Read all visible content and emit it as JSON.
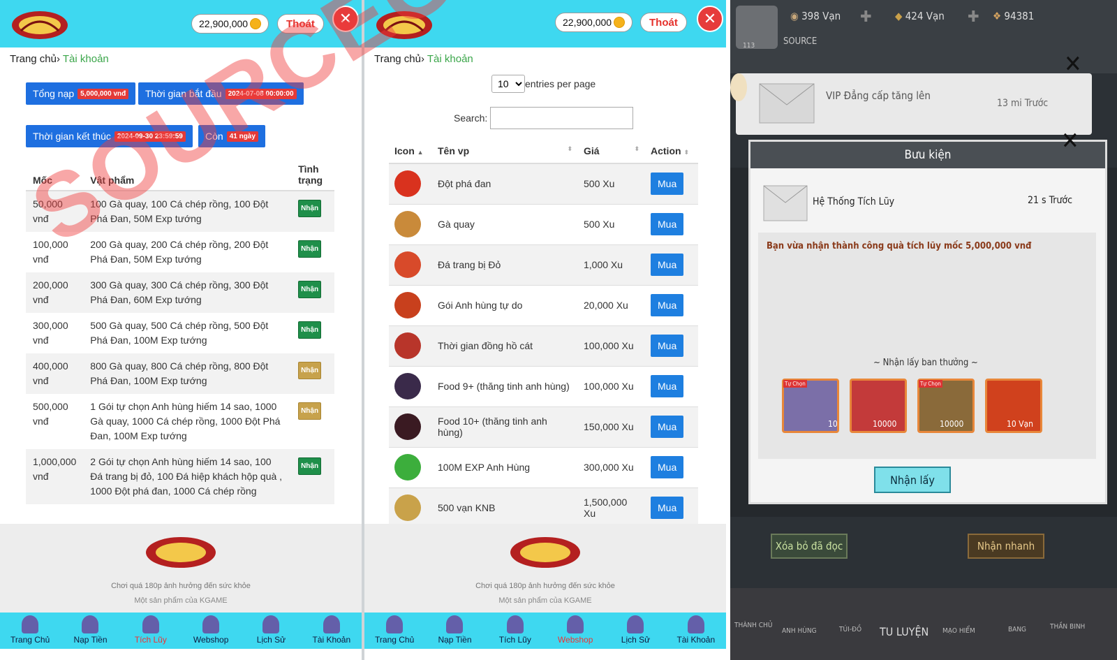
{
  "header": {
    "balance": "22,900,000",
    "logout": "Thoát"
  },
  "p1": {
    "breadcrumb_home": "Trang chủ›",
    "breadcrumb_current": "Tài khoản",
    "pills": [
      {
        "label": "Tổng nạp",
        "badge": "5,000,000 vnđ"
      },
      {
        "label": "Thời gian bắt đầu",
        "badge": "2024-07-08 00:00:00"
      },
      {
        "label": "Thời gian kết thúc",
        "badge": "2024-09-30 23:59:59"
      },
      {
        "label": "Còn",
        "badge": "41 ngày"
      }
    ],
    "columns": [
      "Mốc",
      "Vật phẩm",
      "Tình trạng"
    ],
    "rows": [
      {
        "moc": "50,000 vnđ",
        "item": "100 Gà quay, 100 Cá chép rồng, 100 Đột Phá Đan, 50M Exp tướng",
        "status": "Nhận"
      },
      {
        "moc": "100,000 vnđ",
        "item": "200 Gà quay, 200 Cá chép rồng, 200 Đột Phá Đan, 50M Exp tướng",
        "status": "Nhận"
      },
      {
        "moc": "200,000 vnđ",
        "item": "300 Gà quay, 300 Cá chép rồng, 300 Đột Phá Đan, 60M Exp tướng",
        "status": "Nhận"
      },
      {
        "moc": "300,000 vnđ",
        "item": "500 Gà quay, 500 Cá chép rồng, 500 Đột Phá Đan, 100M Exp tướng",
        "status": "Nhận"
      },
      {
        "moc": "400,000 vnđ",
        "item": "800 Gà quay, 800 Cá chép rồng, 800 Đột Phá Đan, 100M Exp tướng",
        "status": "Nhận"
      },
      {
        "moc": "500,000 vnđ",
        "item": "1 Gói tự chọn Anh hùng hiếm 14 sao, 1000 Gà quay, 1000 Cá chép rồng, 1000 Đột Phá Đan, 100M Exp tướng",
        "status": "Nhận"
      },
      {
        "moc": "1,000,000 vnđ",
        "item": "2 Gói tự chọn Anh hùng hiếm 14 sao, 100 Đá trang bị đỏ, 100 Đá hiệp khách hộp quà , 1000 Đột phá đan, 1000 Cá chép rồng",
        "status": "Nhận"
      }
    ]
  },
  "p2": {
    "breadcrumb_home": "Trang chủ›",
    "breadcrumb_current": "Tài khoản",
    "entries_value": "10",
    "entries_label": "entries per page",
    "search_label": "Search:",
    "columns": [
      "Icon",
      "Tên vp",
      "Giá",
      "Action"
    ],
    "rows": [
      {
        "name": "Đột phá đan",
        "price": "500 Xu",
        "action": "Mua",
        "color": "#d9321e"
      },
      {
        "name": "Gà quay",
        "price": "500 Xu",
        "action": "Mua",
        "color": "#c98a3a"
      },
      {
        "name": "Đá trang bị Đỏ",
        "price": "1,000 Xu",
        "action": "Mua",
        "color": "#d84a2a"
      },
      {
        "name": "Gói Anh hùng tự do",
        "price": "20,000 Xu",
        "action": "Mua",
        "color": "#c8401d"
      },
      {
        "name": "Thời gian đồng hồ cát",
        "price": "100,000 Xu",
        "action": "Mua",
        "color": "#b8352a"
      },
      {
        "name": "Food 9+ (thăng tinh anh hùng)",
        "price": "100,000 Xu",
        "action": "Mua",
        "color": "#3a2a4a"
      },
      {
        "name": "Food 10+ (thăng tinh anh hùng)",
        "price": "150,000 Xu",
        "action": "Mua",
        "color": "#3a1a22"
      },
      {
        "name": "100M EXP Anh Hùng",
        "price": "300,000 Xu",
        "action": "Mua",
        "color": "#3cae3c"
      },
      {
        "name": "500 vạn KNB",
        "price": "1,500,000 Xu",
        "action": "Mua",
        "color": "#c9a24a"
      }
    ]
  },
  "footer": {
    "line1": "Chơi quá 180p ảnh hưởng đến sức khỏe",
    "line2": "Một sản phẩm của KGAME"
  },
  "nav1": [
    {
      "label": "Trang Chủ"
    },
    {
      "label": "Nạp Tiền"
    },
    {
      "label": "Tích Lũy",
      "active": true
    },
    {
      "label": "Webshop"
    },
    {
      "label": "Lịch Sử"
    },
    {
      "label": "Tài Khoản"
    }
  ],
  "nav2": [
    {
      "label": "Trang Chủ"
    },
    {
      "label": "Nạp Tiền"
    },
    {
      "label": "Tích Lũy"
    },
    {
      "label": "Webshop",
      "active": true
    },
    {
      "label": "Lịch Sử"
    },
    {
      "label": "Tài Khoản"
    }
  ],
  "game": {
    "res1": "398 Vạn",
    "res2": "424 Vạn",
    "res3": "94381",
    "source": "SOURCE",
    "level": "113",
    "vip_text": "VIP Đẳng cấp tăng lên",
    "vip_time": "13 mi Trước",
    "dialog_title": "Bưu kiện",
    "mail_from": "Hệ Thống Tích Lũy",
    "mail_time": "21 s Trước",
    "mail_body": "Bạn vừa nhận thành công quà tích lũy mốc 5,000,000 vnđ",
    "reward_title": "Nhận lấy ban thưởng",
    "rewards": [
      {
        "qty": "10",
        "tag": "Tự Chọn"
      },
      {
        "qty": "10000"
      },
      {
        "qty": "10000",
        "tag": "Tự Chọn"
      },
      {
        "qty": "10 Vạn"
      }
    ],
    "claim": "Nhận lấy",
    "delete_read": "Xóa bỏ đã đọc",
    "quick_claim": "Nhận nhanh",
    "nav": [
      "THÀNH CHỦ",
      "ANH HÙNG",
      "TÚI-ĐỒ",
      "TU LUYỆN",
      "MẠO HIỂM",
      "BANG",
      "THẦN BINH"
    ]
  },
  "watermark": "SOURCEGAME.VN",
  "colors": {
    "topbar": "#3ed8f0",
    "primary": "#1e6fe0",
    "badge": "#e43a38",
    "accent": "#3ba64a"
  }
}
